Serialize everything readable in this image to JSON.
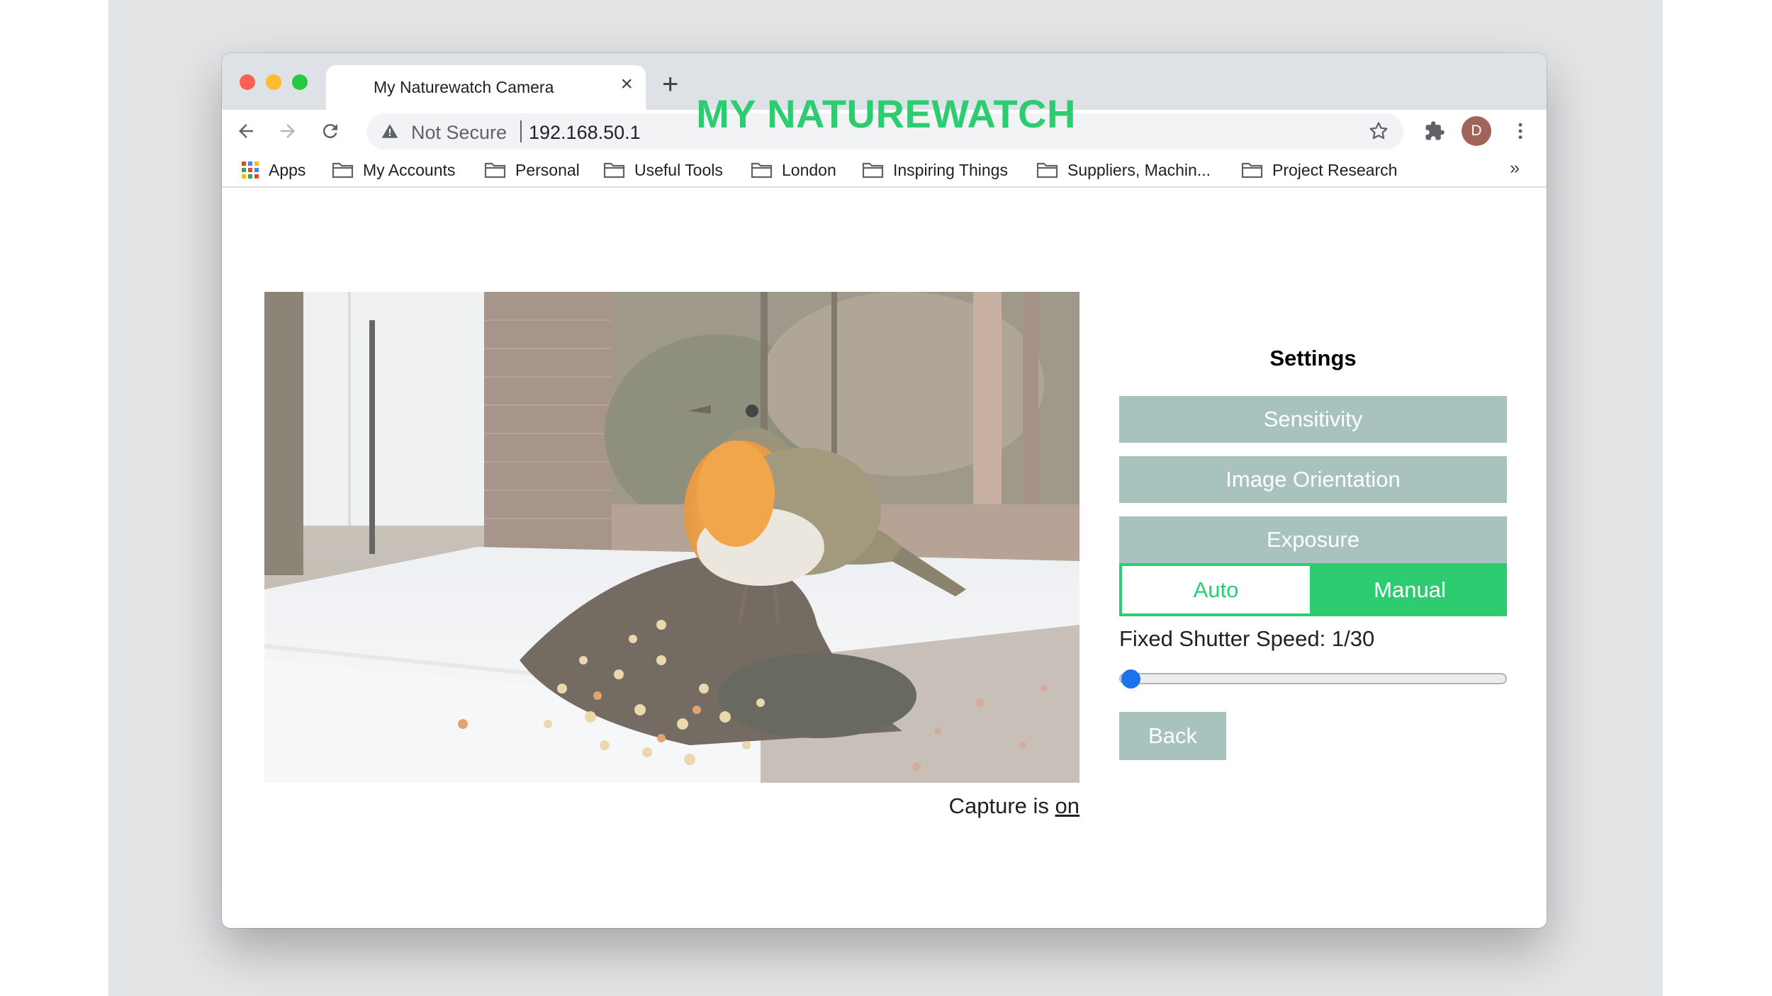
{
  "browser": {
    "tab_title": "My Naturewatch Camera",
    "tab_close_icon": "close-icon",
    "new_tab_icon": "plus-icon",
    "security_label": "Not Secure",
    "url": "192.168.50.1",
    "profile_initial": "D",
    "bookmarks": [
      {
        "label": "Apps",
        "icon": "apps-grid-icon"
      },
      {
        "label": "My Accounts",
        "icon": "folder-icon"
      },
      {
        "label": "Personal",
        "icon": "folder-icon"
      },
      {
        "label": "Useful Tools",
        "icon": "folder-icon"
      },
      {
        "label": "London",
        "icon": "folder-icon"
      },
      {
        "label": "Inspiring Things",
        "icon": "folder-icon"
      },
      {
        "label": "Suppliers, Machin...",
        "icon": "folder-icon"
      },
      {
        "label": "Project Research",
        "icon": "folder-icon"
      }
    ],
    "more_bookmarks": "»"
  },
  "page": {
    "title": "MY NATUREWATCH",
    "capture_prefix": "Capture is",
    "capture_state": "on",
    "settings": {
      "title": "Settings",
      "sensitivity_label": "Sensitivity",
      "orientation_label": "Image Orientation",
      "exposure_label": "Exposure",
      "auto_label": "Auto",
      "manual_label": "Manual",
      "selected_mode": "Manual",
      "shutter_label": "Fixed Shutter Speed: 1/30",
      "shutter_slider_fraction": 0.0,
      "back_label": "Back"
    }
  },
  "colors": {
    "accent_green": "#2ecc71",
    "button_gray": "#a8c2bd",
    "slider_blue": "#1a73e8"
  }
}
